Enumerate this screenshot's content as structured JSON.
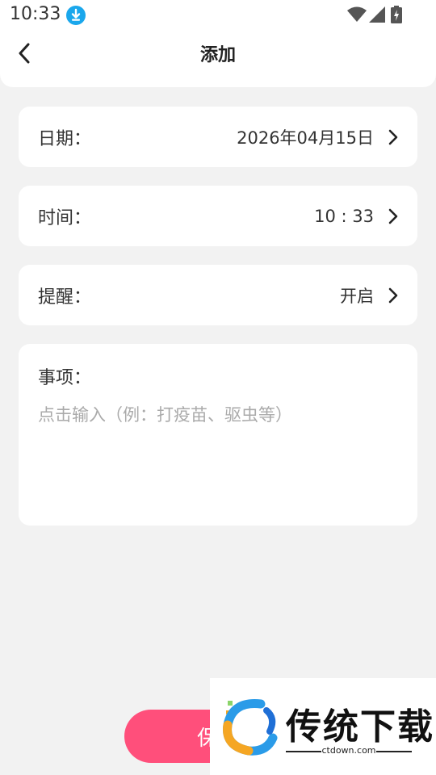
{
  "status_bar": {
    "time": "10:33"
  },
  "header": {
    "title": "添加"
  },
  "form": {
    "date": {
      "label": "日期：",
      "value": "2026年04月15日"
    },
    "time": {
      "label": "时间：",
      "value": "10 : 33"
    },
    "reminder": {
      "label": "提醒：",
      "value": "开启"
    },
    "notes": {
      "label": "事项：",
      "placeholder": "点击输入（例：打疫苗、驱虫等）"
    }
  },
  "save_button": {
    "label": "保存"
  },
  "watermark": {
    "title": "传统下载",
    "domain": "ctdown.com"
  },
  "colors": {
    "accent": "#ff4f7b",
    "download_badge": "#1aa7ec",
    "background": "#f2f2f2"
  }
}
